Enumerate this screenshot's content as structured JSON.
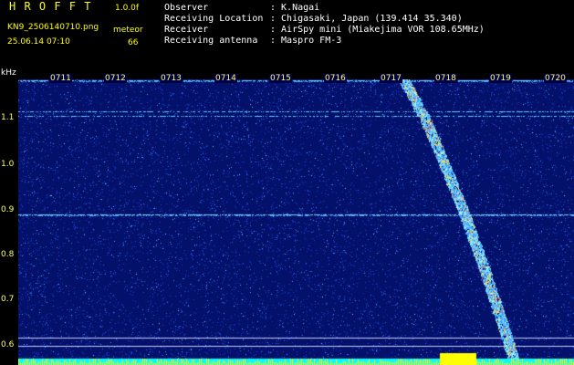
{
  "header": {
    "app_title": "H R O F F T",
    "version": "1.0.0f",
    "file_name": "KN9_2506140710.png",
    "date_time": "25.06.14 07:10",
    "meteor_label": "meteor",
    "meteor_count": "66"
  },
  "info": [
    {
      "key": "Observer",
      "value": ": K.Nagai"
    },
    {
      "key": "Receiving Location",
      "value": ": Chigasaki, Japan (139.414 35.340)"
    },
    {
      "key": "Receiver",
      "value": ": AirSpy mini (Miakejima VOR 108.65MHz)"
    },
    {
      "key": "Receiving antenna",
      "value": ": Maspro FM-3"
    }
  ],
  "axis": {
    "y_unit": "kHz",
    "y_ticks": [
      "1.1",
      "1.0",
      "0.9",
      "0.8",
      "0.7",
      "0.6"
    ],
    "x_ticks": [
      "0711",
      "0712",
      "0713",
      "0714",
      "0715",
      "0716",
      "0717",
      "0718",
      "0719",
      "0720"
    ]
  },
  "colors": {
    "background": "#04116a",
    "text": "#ffff00"
  }
}
